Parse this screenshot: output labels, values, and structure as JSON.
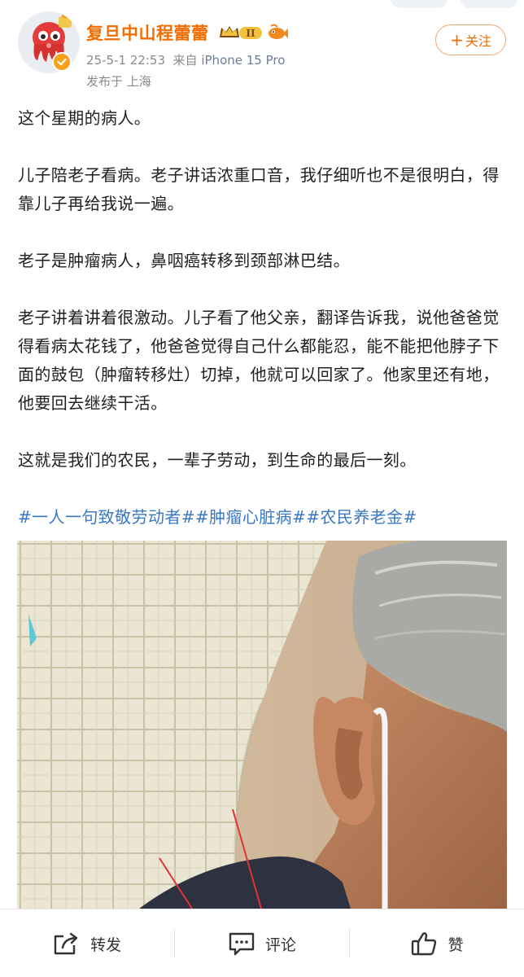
{
  "author": {
    "name": "复旦中山程蕾蕾",
    "vip_level": "II",
    "timestamp": "25-5-1 22:53",
    "source_prefix": "来自",
    "device": "iPhone 15 Pro",
    "location": "发布于 上海",
    "follow_label": "关注",
    "follow_plus": "+"
  },
  "post": {
    "paragraphs": [
      "这个星期的病人。",
      "儿子陪老子看病。老子讲话浓重口音，我仔细听也不是很明白，得靠儿子再给我说一遍。",
      "老子是肿瘤病人，鼻咽癌转移到颈部淋巴结。",
      "老子讲着讲着很激动。儿子看了他父亲，翻译告诉我，说他爸爸觉得看病太花钱了，他爸爸觉得自己什么都能忍，能不能把他脖子下面的鼓包（肿瘤转移灶）切掉，他就可以回家了。他家里还有地，他要回去继续干活。",
      "这就是我们的农民，一辈子劳动，到生命的最后一刻。"
    ],
    "hashtags": "#一人一句致敬劳动者##肿瘤心脏病##农民养老金#"
  },
  "actions": {
    "repost": "转发",
    "comment": "评论",
    "like": "赞"
  },
  "colors": {
    "username": "#f26d00",
    "hashtag": "#3a78c3",
    "meta": "#8a8a8a",
    "follow_border": "#f2a873"
  },
  "icons": {
    "repost": "share-arrow-icon",
    "comment": "comment-bubble-icon",
    "like": "thumbs-up-icon",
    "verified": "verified-badge-icon"
  }
}
